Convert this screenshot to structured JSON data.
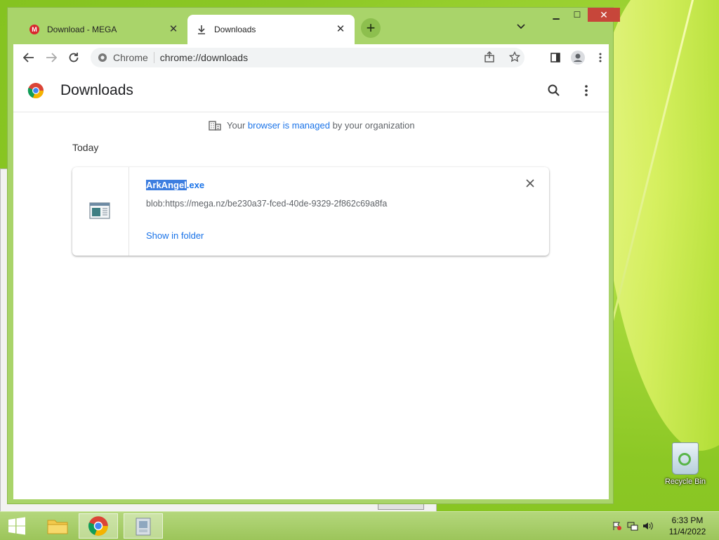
{
  "browser": {
    "tabs": [
      {
        "title": "Download - MEGA",
        "icon": "mega-icon",
        "active": false
      },
      {
        "title": "Downloads",
        "icon": "download-icon",
        "active": true
      }
    ],
    "omnibox": {
      "chip": "Chrome",
      "url": "chrome://downloads"
    }
  },
  "page": {
    "title": "Downloads",
    "managed": {
      "prefix": "Your ",
      "link": "browser is managed",
      "suffix": " by your organization"
    },
    "date_group": "Today",
    "download": {
      "name_selected": "ArkAngel",
      "name_rest": ".exe",
      "url": "blob:https://mega.nz/be230a37-fced-40de-9329-2f862c69a8fa",
      "action": "Show in folder"
    }
  },
  "desktop": {
    "recycle_bin": "Recycle Bin",
    "clock_time": "6:33 PM",
    "clock_date": "11/4/2022"
  },
  "colors": {
    "link": "#1a73e8",
    "accent_green": "#a9d46a",
    "close_red": "#c7463a"
  }
}
